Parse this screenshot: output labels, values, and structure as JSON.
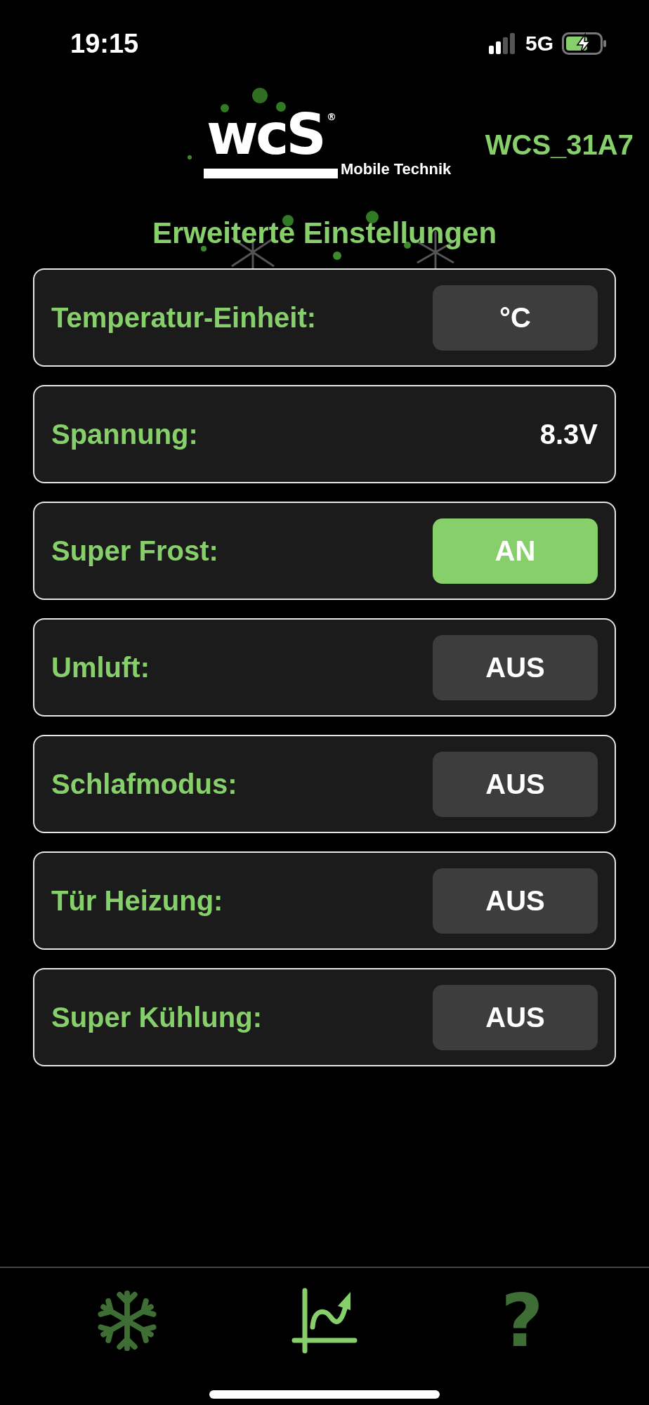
{
  "status_bar": {
    "time": "19:15",
    "network": "5G"
  },
  "header": {
    "logo": {
      "mark": "wcS",
      "registered": "®",
      "tagline": "Mobile Technik"
    },
    "device_id": "WCS_31A7"
  },
  "title": "Erweiterte Einstellungen",
  "settings": [
    {
      "label": "Temperatur-Einheit:",
      "kind": "select",
      "value": "°C"
    },
    {
      "label": "Spannung:",
      "kind": "reading",
      "value": "8.3V"
    },
    {
      "label": "Super Frost:",
      "kind": "toggle",
      "value": "AN",
      "on": true
    },
    {
      "label": "Umluft:",
      "kind": "toggle",
      "value": "AUS",
      "on": false
    },
    {
      "label": "Schlafmodus:",
      "kind": "toggle",
      "value": "AUS",
      "on": false
    },
    {
      "label": "Tür Heizung:",
      "kind": "toggle",
      "value": "AUS",
      "on": false
    },
    {
      "label": "Super Kühlung:",
      "kind": "toggle",
      "value": "AUS",
      "on": false
    }
  ],
  "tabs": [
    {
      "kind": "snowflake",
      "selected": false
    },
    {
      "kind": "chart",
      "selected": true
    },
    {
      "kind": "help",
      "label": "?",
      "selected": false
    }
  ]
}
